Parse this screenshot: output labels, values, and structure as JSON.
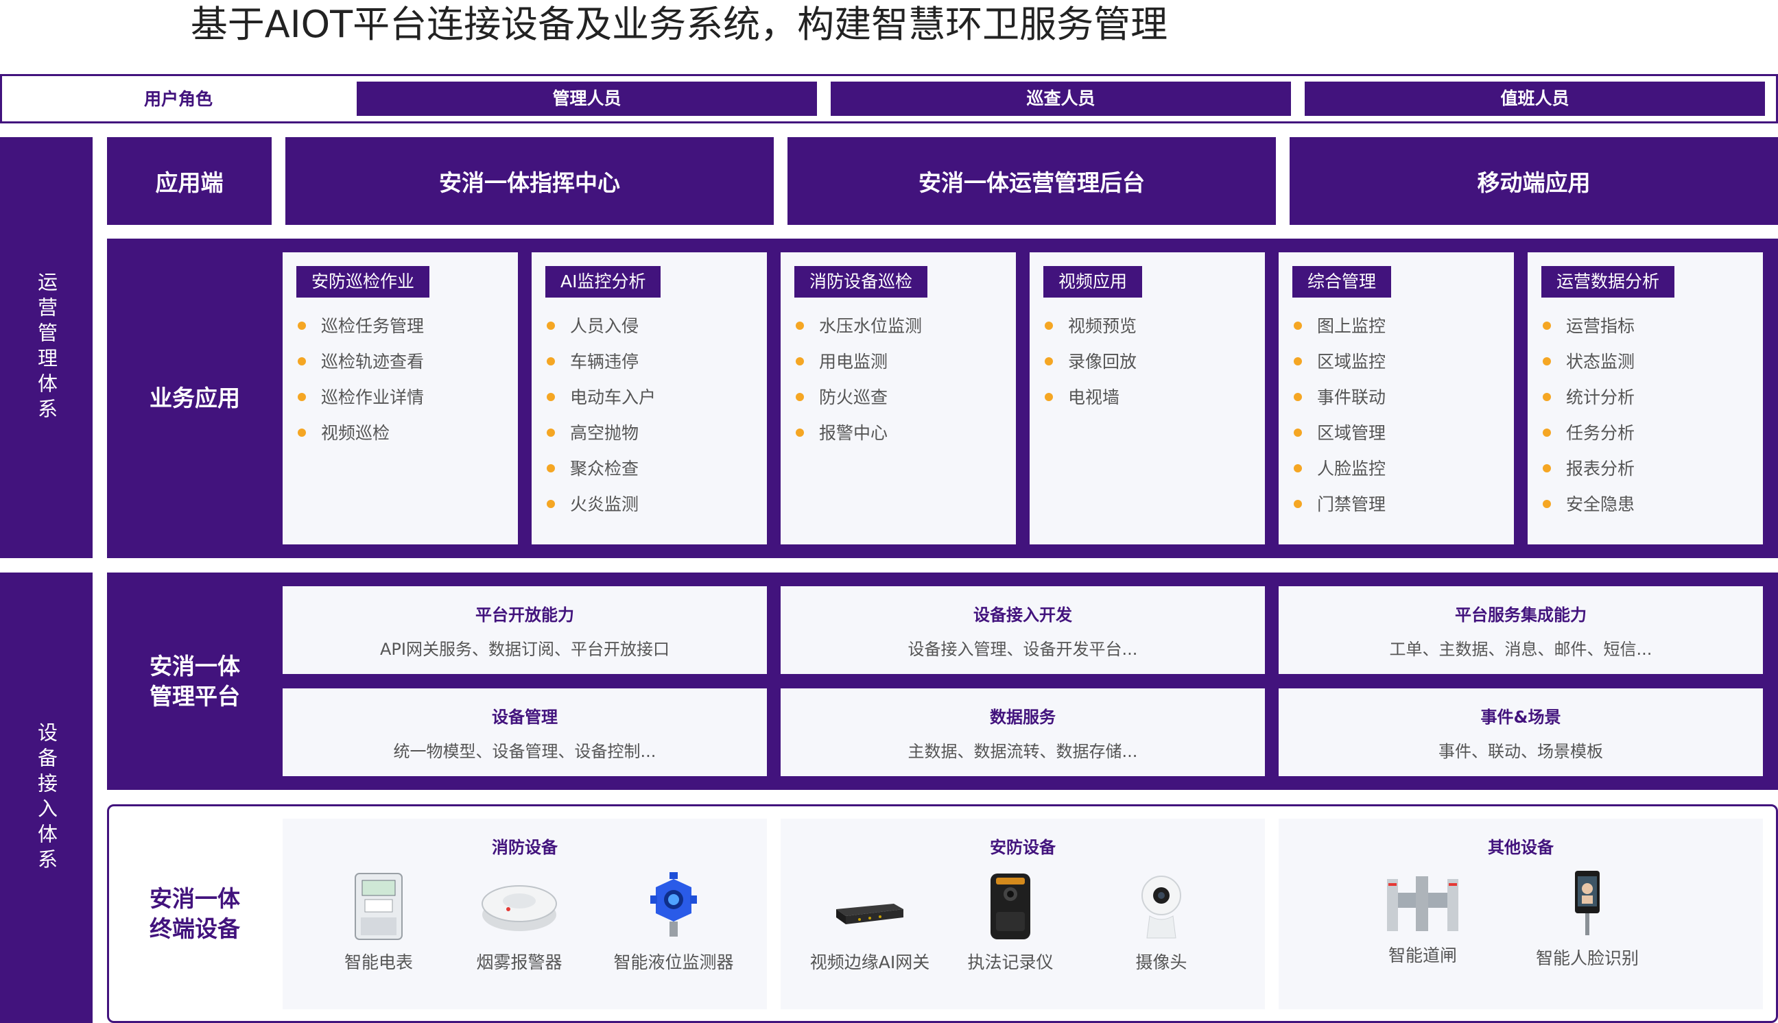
{
  "title": "基于AIOT平台连接设备及业务系统，构建智慧环卫服务管理",
  "roles": {
    "label": "用户角色",
    "items": [
      "管理人员",
      "巡查人员",
      "值班人员"
    ]
  },
  "side_labels": {
    "ops": "运营管理体系",
    "device": "设备接入体系"
  },
  "app_layer": {
    "label": "应用端",
    "items": [
      "安消一体指挥中心",
      "安消一体运营管理后台",
      "移动端应用"
    ]
  },
  "business": {
    "label": "业务应用",
    "cards": [
      {
        "title": "安防巡检作业",
        "items": [
          "巡检任务管理",
          "巡检轨迹查看",
          "巡检作业详情",
          "视频巡检"
        ]
      },
      {
        "title": "AI监控分析",
        "items": [
          "人员入侵",
          "车辆违停",
          "电动车入户",
          "高空抛物",
          "聚众检查",
          "火炎监测"
        ]
      },
      {
        "title": "消防设备巡检",
        "items": [
          "水压水位监测",
          "用电监测",
          "防火巡查",
          "报警中心"
        ]
      },
      {
        "title": "视频应用",
        "items": [
          "视频预览",
          "录像回放",
          "电视墙"
        ]
      },
      {
        "title": "综合管理",
        "items": [
          "图上监控",
          "区域监控",
          "事件联动",
          "区域管理",
          "人脸监控",
          "门禁管理"
        ]
      },
      {
        "title": "运营数据分析",
        "items": [
          "运营指标",
          "状态监测",
          "统计分析",
          "任务分析",
          "报表分析",
          "安全隐患"
        ]
      }
    ]
  },
  "platform": {
    "label_line1": "安消一体",
    "label_line2": "管理平台",
    "cells": [
      {
        "title": "平台开放能力",
        "desc": "API网关服务、数据订阅、平台开放接口"
      },
      {
        "title": "设备接入开发",
        "desc": "设备接入管理、设备开发平台..."
      },
      {
        "title": "平台服务集成能力",
        "desc": "工单、主数据、消息、邮件、短信..."
      },
      {
        "title": "设备管理",
        "desc": "统一物模型、设备管理、设备控制..."
      },
      {
        "title": "数据服务",
        "desc": "主数据、数据流转、数据存储..."
      },
      {
        "title": "事件&场景",
        "desc": "事件、联动、场景模板"
      }
    ]
  },
  "terminal": {
    "label_line1": "安消一体",
    "label_line2": "终端设备",
    "groups": [
      {
        "title": "消防设备",
        "devices": [
          {
            "name": "智能电表",
            "icon": "smart-meter-icon"
          },
          {
            "name": "烟雾报警器",
            "icon": "smoke-alarm-icon"
          },
          {
            "name": "智能液位监测器",
            "icon": "level-monitor-icon"
          }
        ]
      },
      {
        "title": "安防设备",
        "devices": [
          {
            "name": "视频边缘AI网关",
            "icon": "edge-gateway-icon"
          },
          {
            "name": "执法记录仪",
            "icon": "body-camera-icon"
          },
          {
            "name": "摄像头",
            "icon": "camera-icon"
          }
        ]
      },
      {
        "title": "其他设备",
        "devices": [
          {
            "name": "智能道闸",
            "icon": "turnstile-icon"
          },
          {
            "name": "智能人脸识别",
            "icon": "face-recognition-icon"
          }
        ]
      }
    ]
  },
  "colors": {
    "primary": "#42137d",
    "card_bg": "#f6f7fb",
    "bullet": "#f5a623"
  }
}
